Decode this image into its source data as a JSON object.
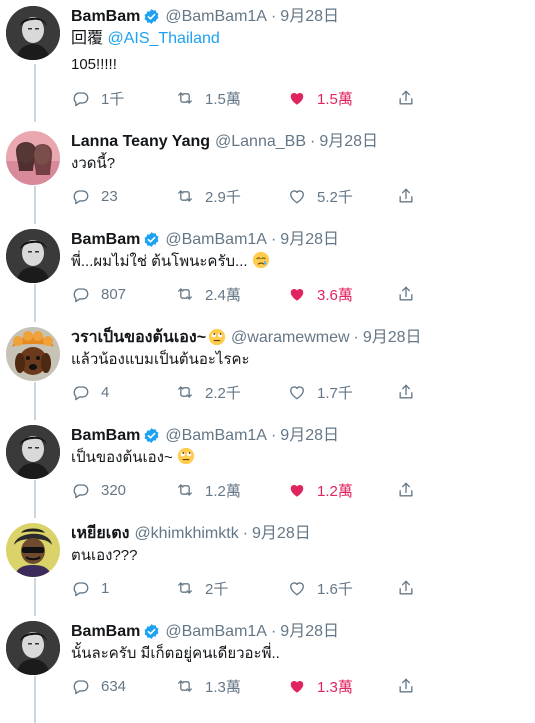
{
  "tweets": [
    {
      "name": "BamBam",
      "verified": true,
      "handle": "@BamBam1A",
      "sep": "·",
      "time": "9月28日",
      "reply_prefix": "回覆 ",
      "reply_mention": "@AIS_Thailand",
      "text": "105!!!!!",
      "replies": "1千",
      "retweets": "1.5萬",
      "likes": "1.5萬",
      "liked": true,
      "avatar": "bambam-avatar"
    },
    {
      "name": "Lanna Teany Yang",
      "verified": false,
      "handle": "@Lanna_BB",
      "sep": "·",
      "time": "9月28日",
      "text": "งวดนี้?",
      "replies": "23",
      "retweets": "2.9千",
      "likes": "5.2千",
      "liked": false,
      "avatar": "lanna-avatar"
    },
    {
      "name": "BamBam",
      "verified": true,
      "handle": "@BamBam1A",
      "sep": "·",
      "time": "9月28日",
      "text": "พี่...ผมไม่ใช่ ต้นโพนะครับ...",
      "emoji": "crying-face",
      "replies": "807",
      "retweets": "2.4萬",
      "likes": "3.6萬",
      "liked": true,
      "avatar": "bambam-avatar"
    },
    {
      "name": "วราเป็นของต้นเอง~",
      "name_emoji": "rolling-eyes-face",
      "verified": false,
      "handle": "@waramewmew",
      "sep": "·",
      "time": "9月28日",
      "text": "แล้วน้องแบมเป็นต้นอะไรคะ",
      "replies": "4",
      "retweets": "2.2千",
      "likes": "1.7千",
      "liked": false,
      "avatar": "dog-avatar"
    },
    {
      "name": "BamBam",
      "verified": true,
      "handle": "@BamBam1A",
      "sep": "·",
      "time": "9月28日",
      "text": "เป็นของต้นเอง~",
      "emoji": "rolling-eyes-face",
      "replies": "320",
      "retweets": "1.2萬",
      "likes": "1.2萬",
      "liked": true,
      "avatar": "bambam-avatar"
    },
    {
      "name": "เหยียเตง",
      "verified": false,
      "handle": "@khimkhimktk",
      "sep": "·",
      "time": "9月28日",
      "text": "ตนเอง???",
      "replies": "1",
      "retweets": "2千",
      "likes": "1.6千",
      "liked": false,
      "avatar": "khim-avatar"
    },
    {
      "name": "BamBam",
      "verified": true,
      "handle": "@BamBam1A",
      "sep": "·",
      "time": "9月28日",
      "text": "นั้นละครับ มีเก็ตอยู่คนเดียวอะพี่..",
      "replies": "634",
      "retweets": "1.3萬",
      "likes": "1.3萬",
      "liked": true,
      "avatar": "bambam-avatar"
    }
  ],
  "colors": {
    "accent": "#1da1f2",
    "like": "#e0245e",
    "muted": "#657786",
    "thread_line": "#ccd6dd"
  }
}
